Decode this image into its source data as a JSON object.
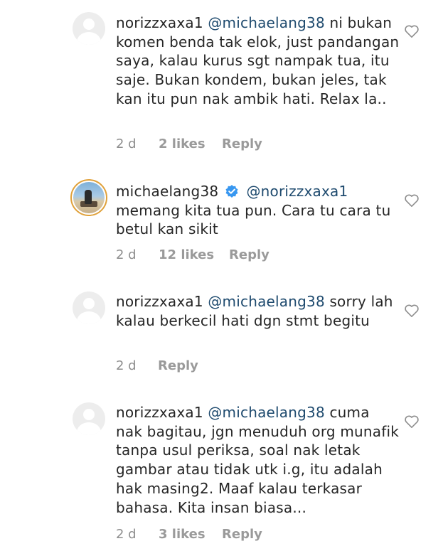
{
  "comments": [
    {
      "username": "norizzxaxa1",
      "mention": "@michaelang38",
      "text": "ni bukan komen benda tak elok, just pandangan saya, kalau kurus sgt nampak tua, itu saje. Bukan kondem, bukan jeles, tak kan itu pun nak ambik hati. Relax la..",
      "age": "2 d",
      "likes": "2 likes",
      "reply": "Reply",
      "verified": false
    },
    {
      "username": "michaelang38",
      "mention": "@norizzxaxa1",
      "text": "memang kita tua pun. Cara tu cara tu betul kan sikit",
      "age": "2 d",
      "likes": "12 likes",
      "reply": "Reply",
      "verified": true
    },
    {
      "username": "norizzxaxa1",
      "mention": "@michaelang38",
      "text": "sorry lah kalau berkecil hati dgn stmt begitu",
      "age": "2 d",
      "likes": "",
      "reply": "Reply",
      "verified": false
    },
    {
      "username": "norizzxaxa1",
      "mention": "@michaelang38",
      "text": "cuma nak bagitau, jgn menuduh org munafik tanpa usul periksa, soal nak letak gambar atau tidak utk i.g, itu adalah hak masing2.  Maaf kalau terkasar bahasa. Kita insan biasa...",
      "age": "2 d",
      "likes": "3 likes",
      "reply": "Reply",
      "verified": false
    }
  ],
  "icons": {
    "like": "heart-outline-icon",
    "verified": "verified-badge-icon",
    "verified_color": "#3897f0"
  }
}
